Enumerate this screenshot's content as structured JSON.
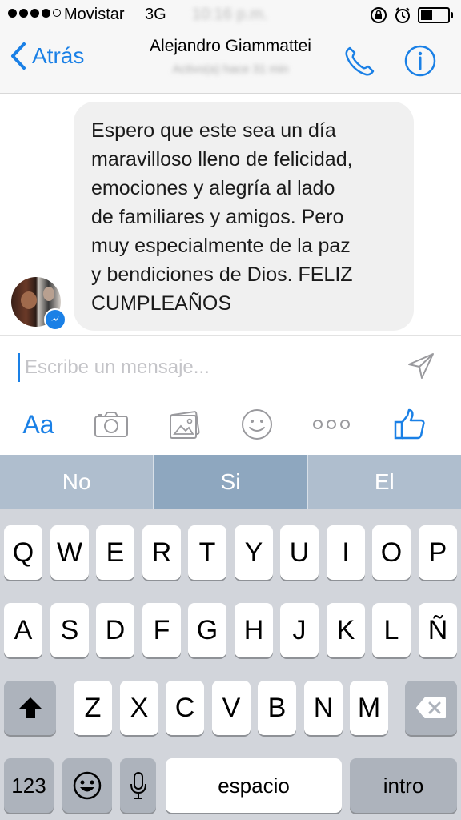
{
  "status_bar": {
    "carrier": "Movistar",
    "network": "3G",
    "time": "10:16 p.m."
  },
  "nav": {
    "back_label": "Atrás",
    "contact_name": "Alejandro Giammattei",
    "active_status": "Activo(a) hace 31 min"
  },
  "message": {
    "text": "Espero que este sea un día\nmaravilloso lleno de felicidad,\nemociones y alegría al lado\nde familiares y amigos. Pero\nmuy especialmente de la paz\ny bendiciones de Dios. FELIZ\nCUMPLEAÑOS"
  },
  "composer": {
    "placeholder": "Escribe un mensaje...",
    "text_style_label": "Aa"
  },
  "suggestions": [
    "No",
    "Si",
    "El"
  ],
  "keyboard": {
    "row1": [
      "Q",
      "W",
      "E",
      "R",
      "T",
      "Y",
      "U",
      "I",
      "O",
      "P"
    ],
    "row2": [
      "A",
      "S",
      "D",
      "F",
      "G",
      "H",
      "J",
      "K",
      "L",
      "Ñ"
    ],
    "row3": [
      "Z",
      "X",
      "C",
      "V",
      "B",
      "N",
      "M"
    ],
    "numbers_label": "123",
    "space_label": "espacio",
    "return_label": "intro"
  },
  "colors": {
    "accent": "#1a80e6",
    "bubble": "#f0f0f0",
    "keyboard_bg": "#d2d5db",
    "suggestion_bar": "#8ea7bf"
  }
}
